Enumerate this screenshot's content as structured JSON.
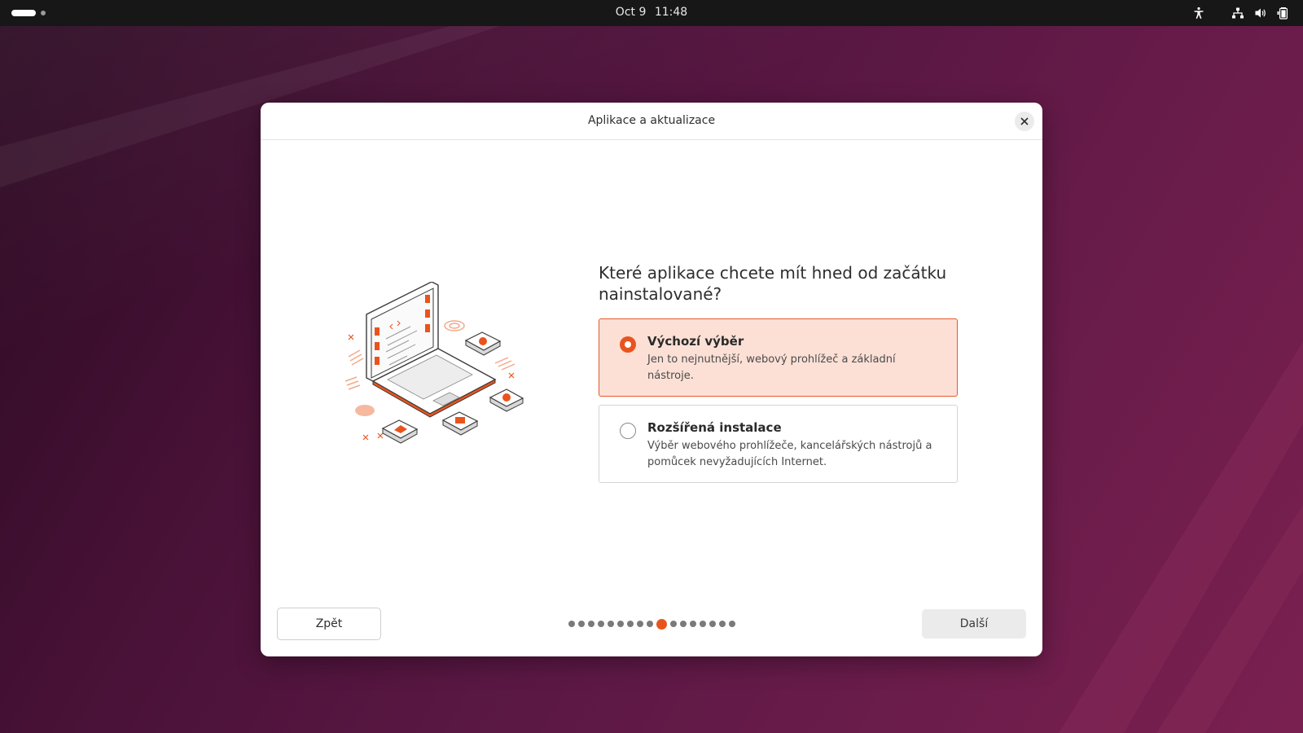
{
  "topbar": {
    "date": "Oct 9",
    "time": "11:48",
    "tray_icons": [
      "accessibility-icon",
      "network-icon",
      "volume-icon",
      "battery-icon"
    ]
  },
  "dialog": {
    "title": "Aplikace a aktualizace",
    "question": "Které aplikace chcete mít hned od začátku nainstalované?",
    "options": [
      {
        "title": "Výchozí výběr",
        "description": "Jen to nejnutnější, webový prohlížeč a základní nástroje.",
        "selected": true
      },
      {
        "title": "Rozšířená instalace",
        "description": "Výběr webového prohlížeče, kancelářských nástrojů a pomůcek nevyžadujících Internet.",
        "selected": false
      }
    ],
    "back_label": "Zpět",
    "next_label": "Další",
    "progress": {
      "total_steps": 17,
      "current_step": 10
    }
  },
  "colors": {
    "accent": "#e9541e",
    "selected_bg": "#fce0d6",
    "topbar_bg": "#171717"
  }
}
